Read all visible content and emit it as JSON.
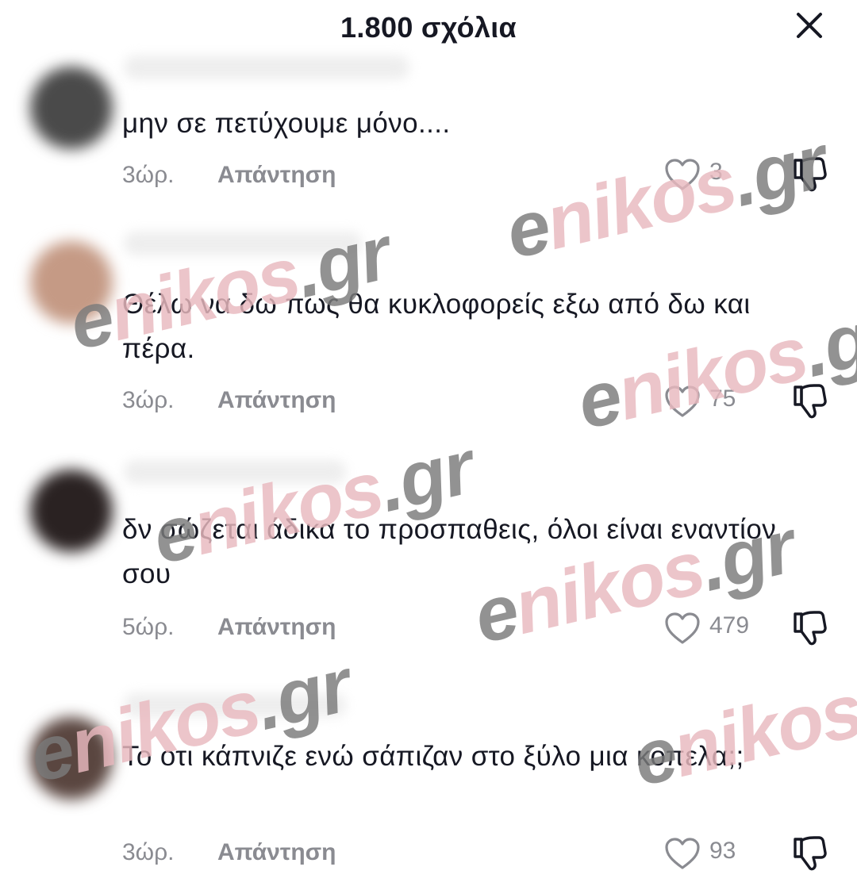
{
  "header": {
    "title": "1.800 σχόλια"
  },
  "watermark": {
    "e": "e",
    "nikos": "nikos",
    "gr": ".gr"
  },
  "comments": [
    {
      "text": "μην σε πετύχουμε μόνο....",
      "time": "3ώρ.",
      "reply_label": "Απάντηση",
      "likes": "3",
      "avatar_color": "#4a4a4a"
    },
    {
      "text": "Θέλω να δω πως θα κυκλοφορείς εξω από δω και πέρα.",
      "time": "3ώρ.",
      "reply_label": "Απάντηση",
      "likes": "75",
      "avatar_color": "#c59a85"
    },
    {
      "text": "δν σώζεται άδικα το προσπαθεις, όλοι είναι εναντίον σου",
      "time": "5ώρ.",
      "reply_label": "Απάντηση",
      "likes": "479",
      "avatar_color": "#2a2222"
    },
    {
      "text": "Το οτι κάπνιζε ενώ σάπιζαν στο ξύλο μια κοπελα;;",
      "time": "3ώρ.",
      "reply_label": "Απάντηση",
      "likes": "93",
      "avatar_color": "#5a4640"
    }
  ],
  "colors": {
    "text": "#161823",
    "secondary": "#8a8b91",
    "watermark_grey": "#7b7b7b",
    "watermark_pink": "#e9b9bf"
  },
  "icons": {
    "close": "close-icon",
    "like": "heart-outline-icon",
    "dislike": "thumbs-down-icon"
  }
}
